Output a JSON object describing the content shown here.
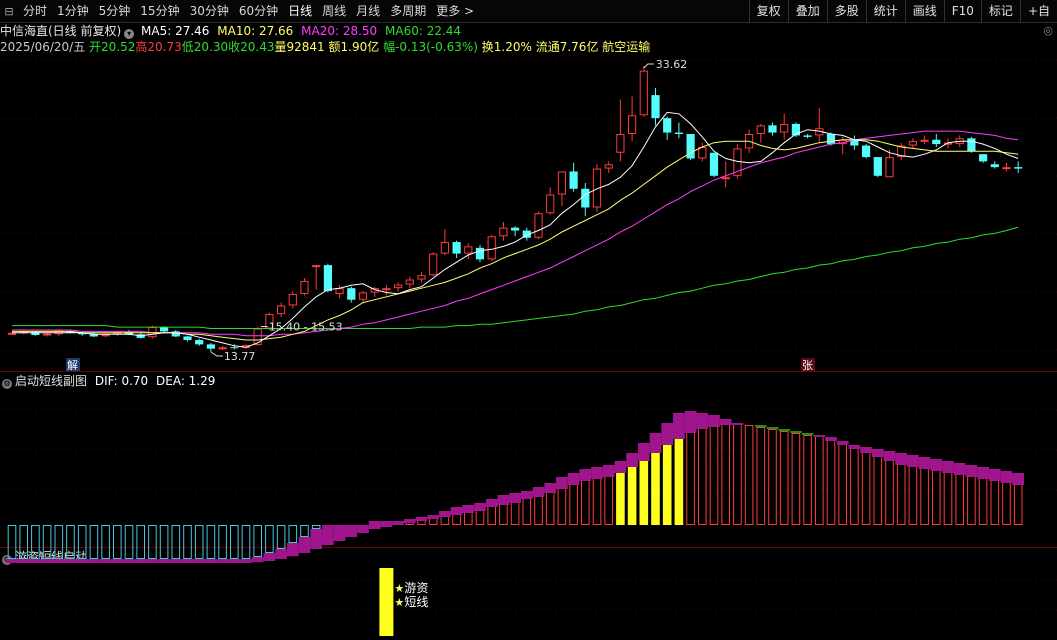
{
  "toolbar": {
    "tabs": [
      "分时",
      "1分钟",
      "5分钟",
      "15分钟",
      "30分钟",
      "60分钟",
      "日线",
      "周线",
      "月线",
      "多周期",
      "更多 >"
    ],
    "active_tab": "日线",
    "right_buttons": [
      "复权",
      "叠加",
      "多股",
      "统计",
      "画线",
      "F10",
      "标记",
      "+自"
    ]
  },
  "header": {
    "title": "中信海直(日线 前复权)",
    "ma5": "MA5: 27.46",
    "ma10": "MA10: 27.66",
    "ma20": "MA20: 28.50",
    "ma60": "MA60: 22.44",
    "date": "2025/06/20/五",
    "open": "开20.52",
    "high": "高20.73",
    "low": "低20.30",
    "close": "收20.43",
    "volume": "量92841",
    "amount": "额1.90亿",
    "change": "幅-0.13(-0.63%)",
    "turnover": "换1.20%",
    "float_cap": "流通7.76亿",
    "industry": "航空运输"
  },
  "colors": {
    "up": "#ff3a3a",
    "down": "#54fcfc",
    "ma5": "#ffffff",
    "ma10": "#ffff6a",
    "ma20": "#ff3cff",
    "ma60": "#2fdc2f",
    "grid": "#3a0000",
    "macd_purple": "#a0148c",
    "macd_green": "#0a9a0a",
    "macd_yellow": "#ffff1e",
    "macd_cyan": "#46c8dc"
  },
  "main_chart": {
    "annotations": {
      "high": "33.62",
      "low": "13.77",
      "range": "15.40 - 15.53",
      "left_marker": "解",
      "right_marker": "张"
    }
  },
  "sub_chart1": {
    "title": "启动短线副图",
    "dif": "DIF: 0.70",
    "dea": "DEA: 1.29"
  },
  "sub_chart2": {
    "title": "游资短线启动",
    "label1": "游资",
    "label2": "短线"
  },
  "chart_data": {
    "type": "candlestick",
    "candles": [
      [
        15.05,
        15.15,
        14.95,
        15.1
      ],
      [
        15.1,
        15.25,
        15.0,
        15.2
      ],
      [
        15.15,
        15.2,
        14.9,
        14.95
      ],
      [
        14.95,
        15.1,
        14.85,
        15.05
      ],
      [
        15.0,
        15.3,
        14.9,
        15.25
      ],
      [
        15.2,
        15.3,
        15.05,
        15.1
      ],
      [
        15.1,
        15.2,
        14.9,
        15.0
      ],
      [
        15.0,
        15.15,
        14.8,
        14.85
      ],
      [
        14.9,
        15.05,
        14.8,
        15.0
      ],
      [
        15.0,
        15.2,
        14.9,
        15.15
      ],
      [
        15.15,
        15.3,
        14.95,
        15.0
      ],
      [
        15.0,
        15.1,
        14.7,
        14.75
      ],
      [
        14.8,
        15.6,
        14.7,
        15.5
      ],
      [
        15.5,
        15.55,
        15.15,
        15.2
      ],
      [
        15.2,
        15.3,
        14.8,
        14.85
      ],
      [
        14.85,
        14.9,
        14.5,
        14.6
      ],
      [
        14.6,
        14.7,
        14.2,
        14.3
      ],
      [
        14.3,
        14.4,
        13.77,
        14.0
      ],
      [
        14.0,
        14.2,
        13.9,
        14.1
      ],
      [
        14.1,
        14.3,
        13.95,
        14.05
      ],
      [
        14.05,
        14.3,
        14.0,
        14.25
      ],
      [
        14.25,
        15.53,
        14.2,
        15.4
      ],
      [
        15.4,
        16.5,
        15.3,
        16.4
      ],
      [
        16.4,
        17.2,
        16.2,
        17.0
      ],
      [
        17.0,
        18.0,
        16.8,
        17.8
      ],
      [
        17.8,
        18.9,
        17.7,
        18.7
      ],
      [
        19.75,
        19.8,
        18.1,
        19.8
      ],
      [
        19.8,
        19.9,
        17.9,
        18.0
      ],
      [
        17.8,
        18.4,
        17.5,
        18.2
      ],
      [
        18.2,
        18.3,
        17.2,
        17.4
      ],
      [
        17.4,
        18.0,
        17.2,
        17.9
      ],
      [
        17.9,
        18.3,
        17.6,
        18.2
      ],
      [
        18.1,
        18.4,
        17.7,
        18.2
      ],
      [
        18.2,
        18.6,
        17.95,
        18.45
      ],
      [
        18.45,
        19.0,
        18.2,
        18.8
      ],
      [
        18.8,
        19.3,
        18.6,
        19.1
      ],
      [
        19.1,
        20.7,
        19.0,
        20.6
      ],
      [
        20.6,
        22.3,
        20.5,
        21.4
      ],
      [
        21.4,
        21.5,
        20.3,
        20.6
      ],
      [
        20.6,
        21.3,
        20.2,
        21.1
      ],
      [
        21.0,
        21.2,
        20.0,
        20.2
      ],
      [
        20.2,
        21.9,
        20.1,
        21.8
      ],
      [
        21.8,
        22.8,
        21.5,
        22.4
      ],
      [
        22.4,
        22.5,
        21.8,
        22.2
      ],
      [
        22.2,
        22.4,
        21.5,
        21.7
      ],
      [
        21.7,
        23.5,
        21.6,
        23.4
      ],
      [
        23.4,
        25.2,
        23.3,
        24.7
      ],
      [
        24.7,
        26.3,
        23.9,
        26.3
      ],
      [
        26.3,
        26.9,
        24.9,
        25.1
      ],
      [
        25.1,
        25.5,
        23.2,
        23.8
      ],
      [
        23.8,
        26.8,
        23.5,
        26.5
      ],
      [
        26.5,
        27.0,
        26.2,
        26.8
      ],
      [
        27.6,
        31.3,
        27.0,
        28.9
      ],
      [
        28.9,
        31.5,
        28.4,
        30.2
      ],
      [
        30.2,
        33.62,
        30.1,
        33.3
      ],
      [
        31.6,
        32.1,
        29.5,
        30.0
      ],
      [
        30.0,
        30.1,
        28.5,
        29.0
      ],
      [
        29.0,
        29.7,
        28.6,
        28.9
      ],
      [
        28.9,
        28.9,
        27.1,
        27.2
      ],
      [
        27.2,
        28.3,
        27.0,
        28.0
      ],
      [
        27.6,
        27.6,
        25.9,
        26.0
      ],
      [
        25.9,
        27.0,
        25.2,
        25.9
      ],
      [
        26.0,
        28.2,
        25.8,
        27.9
      ],
      [
        27.9,
        29.2,
        27.6,
        28.9
      ],
      [
        28.9,
        29.6,
        28.3,
        29.5
      ],
      [
        29.5,
        29.7,
        28.8,
        29.0
      ],
      [
        29.0,
        30.3,
        28.5,
        29.6
      ],
      [
        29.6,
        29.7,
        28.7,
        28.8
      ],
      [
        28.8,
        28.9,
        28.6,
        28.7
      ],
      [
        28.8,
        30.7,
        28.3,
        29.3
      ],
      [
        28.9,
        29.0,
        28.1,
        28.2
      ],
      [
        28.2,
        28.7,
        27.5,
        28.5
      ],
      [
        28.5,
        28.8,
        27.8,
        28.1
      ],
      [
        28.1,
        28.2,
        27.2,
        27.3
      ],
      [
        27.3,
        27.3,
        25.9,
        26.0
      ],
      [
        25.9,
        27.8,
        25.9,
        27.3
      ],
      [
        27.3,
        28.3,
        27.1,
        28.1
      ],
      [
        28.1,
        28.6,
        27.9,
        28.4
      ],
      [
        28.4,
        28.8,
        28.2,
        28.5
      ],
      [
        28.5,
        28.9,
        28.0,
        28.2
      ],
      [
        28.2,
        28.6,
        27.9,
        28.3
      ],
      [
        28.2,
        28.8,
        28.0,
        28.6
      ],
      [
        28.6,
        28.7,
        27.6,
        27.7
      ],
      [
        27.5,
        27.5,
        26.9,
        27.0
      ],
      [
        26.8,
        27.0,
        26.5,
        26.6
      ],
      [
        26.6,
        26.9,
        26.3,
        26.6
      ],
      [
        26.6,
        27.0,
        26.2,
        26.5
      ]
    ],
    "x_labels": [],
    "ma5": [
      15.1,
      15.1,
      15.1,
      15.1,
      15.1,
      15.1,
      15.1,
      15.0,
      15.0,
      15.0,
      15.0,
      14.9,
      15.0,
      15.1,
      15.1,
      15.0,
      14.8,
      14.6,
      14.4,
      14.2,
      14.1,
      14.4,
      14.9,
      15.4,
      16.1,
      16.9,
      17.6,
      18.1,
      18.2,
      18.4,
      18.5,
      18.1,
      17.9,
      17.8,
      18.1,
      18.3,
      18.9,
      19.5,
      20.0,
      20.5,
      20.8,
      20.9,
      21.1,
      21.4,
      21.9,
      22.2,
      22.6,
      23.4,
      24.0,
      24.7,
      25.1,
      25.4,
      25.9,
      26.7,
      28.0,
      29.4,
      30.4,
      30.3,
      29.6,
      28.7,
      27.7,
      27.2,
      27.0,
      26.9,
      27.0,
      27.6,
      28.3,
      28.9,
      29.2,
      29.1,
      28.9,
      28.8,
      28.5,
      28.4,
      28.0,
      27.6,
      27.4,
      27.3,
      27.5,
      27.8,
      28.3,
      28.4,
      28.4,
      28.2,
      27.9,
      27.5,
      27.2
    ],
    "ma10": [
      15.2,
      15.2,
      15.2,
      15.2,
      15.2,
      15.2,
      15.1,
      15.1,
      15.1,
      15.1,
      15.1,
      15.1,
      15.1,
      15.1,
      15.1,
      15.0,
      15.0,
      14.9,
      14.8,
      14.7,
      14.6,
      14.6,
      14.7,
      14.8,
      15.0,
      15.2,
      15.6,
      16.0,
      16.3,
      16.7,
      17.2,
      17.4,
      17.6,
      17.8,
      18.0,
      18.2,
      18.4,
      18.6,
      18.9,
      19.2,
      19.6,
      19.9,
      20.3,
      20.6,
      20.9,
      21.2,
      21.6,
      22.1,
      22.5,
      22.9,
      23.3,
      23.7,
      24.3,
      24.8,
      25.4,
      26.0,
      26.6,
      27.1,
      27.6,
      28.0,
      28.3,
      28.4,
      28.4,
      28.4,
      28.1,
      27.9,
      27.8,
      27.9,
      28.1,
      28.3,
      28.4,
      28.5,
      28.5,
      28.5,
      28.4,
      28.2,
      28.0,
      27.9,
      27.8,
      27.7,
      27.7,
      27.7,
      27.7,
      27.7,
      27.7,
      27.6,
      27.5
    ],
    "ma20": [
      15.3,
      15.3,
      15.3,
      15.3,
      15.3,
      15.3,
      15.2,
      15.2,
      15.2,
      15.2,
      15.2,
      15.2,
      15.1,
      15.1,
      15.1,
      15.1,
      15.1,
      15.0,
      15.0,
      15.0,
      14.9,
      14.9,
      14.9,
      15.0,
      15.0,
      15.1,
      15.2,
      15.3,
      15.4,
      15.5,
      15.7,
      15.8,
      16.0,
      16.2,
      16.4,
      16.6,
      16.8,
      17.0,
      17.3,
      17.5,
      17.8,
      18.1,
      18.4,
      18.7,
      19.0,
      19.3,
      19.6,
      20.0,
      20.4,
      20.8,
      21.2,
      21.6,
      22.1,
      22.5,
      23.0,
      23.5,
      24.0,
      24.4,
      24.9,
      25.3,
      25.7,
      26.0,
      26.3,
      26.6,
      26.9,
      27.1,
      27.3,
      27.6,
      27.8,
      28.0,
      28.2,
      28.3,
      28.5,
      28.6,
      28.7,
      28.8,
      28.9,
      29.0,
      29.1,
      29.1,
      29.1,
      29.1,
      29.0,
      28.9,
      28.8,
      28.6,
      28.5
    ],
    "ma60": [
      15.6,
      15.6,
      15.6,
      15.6,
      15.6,
      15.6,
      15.6,
      15.6,
      15.6,
      15.5,
      15.5,
      15.5,
      15.5,
      15.5,
      15.5,
      15.5,
      15.5,
      15.4,
      15.4,
      15.4,
      15.4,
      15.4,
      15.4,
      15.4,
      15.4,
      15.4,
      15.4,
      15.4,
      15.4,
      15.4,
      15.4,
      15.4,
      15.4,
      15.4,
      15.4,
      15.5,
      15.5,
      15.5,
      15.6,
      15.6,
      15.7,
      15.7,
      15.8,
      15.9,
      16.0,
      16.1,
      16.2,
      16.3,
      16.4,
      16.6,
      16.7,
      16.9,
      17.0,
      17.2,
      17.4,
      17.5,
      17.7,
      17.9,
      18.0,
      18.2,
      18.4,
      18.5,
      18.7,
      18.8,
      19.0,
      19.2,
      19.3,
      19.5,
      19.6,
      19.8,
      19.9,
      20.1,
      20.2,
      20.4,
      20.5,
      20.7,
      20.8,
      21.0,
      21.1,
      21.3,
      21.4,
      21.6,
      21.7,
      21.9,
      22.0,
      22.2,
      22.44
    ],
    "sub1_bars": [
      -0.85,
      -0.85,
      -0.85,
      -0.85,
      -0.85,
      -0.85,
      -0.85,
      -0.85,
      -0.85,
      -0.85,
      -0.85,
      -0.85,
      -0.85,
      -0.85,
      -0.85,
      -0.85,
      -0.85,
      -0.85,
      -0.85,
      -0.85,
      -0.85,
      -0.8,
      -0.7,
      -0.6,
      -0.45,
      -0.3,
      -0.1,
      0,
      0,
      0,
      0,
      0.1,
      0.1,
      0.1,
      0.15,
      0.2,
      0.25,
      0.35,
      0.45,
      0.5,
      0.55,
      0.65,
      0.75,
      0.8,
      0.85,
      0.95,
      1.05,
      1.2,
      1.3,
      1.4,
      1.45,
      1.5,
      1.6,
      1.8,
      2.05,
      2.3,
      2.55,
      2.8,
      2.85,
      2.8,
      2.75,
      2.65,
      2.55,
      2.5,
      2.45,
      2.4,
      2.35,
      2.3,
      2.25,
      2.25,
      2.2,
      2.1,
      2.0,
      1.95,
      1.9,
      1.85,
      1.8,
      1.75,
      1.7,
      1.65,
      1.6,
      1.55,
      1.5,
      1.45,
      1.4,
      1.35,
      1.3
    ],
    "sub1_dea": [
      -0.95,
      -0.95,
      -0.95,
      -0.95,
      -0.95,
      -0.95,
      -0.95,
      -0.95,
      -0.95,
      -0.95,
      -0.95,
      -0.95,
      -0.95,
      -0.95,
      -0.95,
      -0.95,
      -0.95,
      -0.95,
      -0.95,
      -0.95,
      -0.95,
      -0.93,
      -0.9,
      -0.85,
      -0.78,
      -0.7,
      -0.6,
      -0.5,
      -0.4,
      -0.3,
      -0.2,
      -0.1,
      -0.05,
      0,
      0.05,
      0.1,
      0.15,
      0.2,
      0.25,
      0.3,
      0.35,
      0.45,
      0.5,
      0.55,
      0.65,
      0.7,
      0.8,
      0.9,
      1.0,
      1.1,
      1.15,
      1.2,
      1.3,
      1.45,
      1.6,
      1.8,
      2.0,
      2.15,
      2.3,
      2.4,
      2.45,
      2.5,
      2.5,
      2.5,
      2.5,
      2.45,
      2.4,
      2.35,
      2.3,
      2.2,
      2.1,
      2.0,
      1.9,
      1.8,
      1.7,
      1.6,
      1.5,
      1.45,
      1.4,
      1.35,
      1.3,
      1.25,
      1.2,
      1.15,
      1.1,
      1.05,
      1.0
    ],
    "sub1_highlight": [
      52,
      53,
      54,
      55,
      56,
      57
    ]
  }
}
